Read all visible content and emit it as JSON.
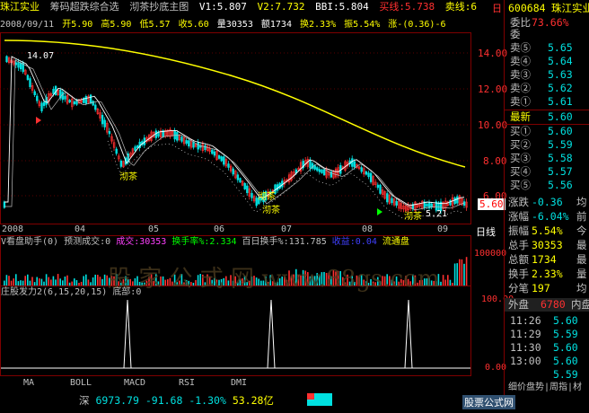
{
  "header": {
    "stock_name": "珠江实业",
    "indicator_name": "筹码超跌综合选",
    "indicator2_name": "沏茶抄底主图",
    "v1": "V1:5.807",
    "v2": "V2:7.732",
    "bbi": "BBI:5.804",
    "buy_line": "买线:5.738",
    "sell_line": "卖线:6",
    "corner_label": "日"
  },
  "info_row": {
    "date": "2008/09/11",
    "open": "开5.90",
    "high": "高5.90",
    "low": "低5.57",
    "close": "收5.60",
    "volume": "量30353",
    "amount": "额1734",
    "turnover": "换2.33%",
    "amplitude": "振5.54%",
    "change": "涨-(0.36)-6"
  },
  "main_chart": {
    "price_labels": [
      "14.00",
      "12.00",
      "10.00",
      "8.00",
      "6.00"
    ],
    "current_price": "5.60",
    "high_annotation": "14.07",
    "low_annotation": "5.21",
    "marker_labels": [
      "沏茶",
      "沏茶",
      "沏茶",
      "沏茶"
    ],
    "date_labels": [
      "2008",
      "04",
      "05",
      "06",
      "07",
      "08",
      "09"
    ],
    "period_label": "日线",
    "colors": {
      "up": "#ff3030",
      "down": "#00e0e0",
      "ma_long": "#ffff00",
      "ma_white": "#ffffff"
    }
  },
  "volume_panel": {
    "title": "V看盘助手(0)",
    "items": [
      {
        "label": "预测成交:0",
        "color": "#c0c0c0"
      },
      {
        "label": "成交:30353",
        "color": "#ff40ff"
      },
      {
        "label": "换手率%:2.334",
        "color": "#00ff00"
      },
      {
        "label": "百日换手%:131.785",
        "color": "#c0c0c0"
      },
      {
        "label": "收益:0.04",
        "color": "#4040ff"
      },
      {
        "label": "流通盘",
        "color": "#ffff00"
      }
    ],
    "axis_label": "100000"
  },
  "bottom_panel": {
    "title": "庄股发力2(6,15,20,15)",
    "subtitle": "底部:0",
    "axis_top": "100.00",
    "axis_bottom": "0.00"
  },
  "watermark": "股 家 公 式 网 www.88gs.com",
  "tabs": [
    "MA",
    "BOLL",
    "MACD",
    "RSI",
    "DMI"
  ],
  "status": {
    "index_name": "深",
    "index_value": "6973.79",
    "index_change": "-91.68",
    "index_pct": "-1.30%",
    "amount": "53.28亿",
    "site": "股票公式网"
  },
  "quote_panel": {
    "code": "600684",
    "name": "珠江实业",
    "wei_bi_label": "委比",
    "wei_bi": "73.66%",
    "wei_cha_label": "委",
    "sells": [
      {
        "label": "卖⑤",
        "price": "5.65"
      },
      {
        "label": "卖④",
        "price": "5.64"
      },
      {
        "label": "卖③",
        "price": "5.63"
      },
      {
        "label": "卖②",
        "price": "5.62"
      },
      {
        "label": "卖①",
        "price": "5.61"
      }
    ],
    "latest_label": "最新",
    "latest": "5.60",
    "buys": [
      {
        "label": "买①",
        "price": "5.60"
      },
      {
        "label": "买②",
        "price": "5.59"
      },
      {
        "label": "买③",
        "price": "5.58"
      },
      {
        "label": "买④",
        "price": "5.57"
      },
      {
        "label": "买⑤",
        "price": "5.56"
      }
    ],
    "stats": [
      {
        "label": "涨跌",
        "value": "-0.36",
        "extra": "均"
      },
      {
        "label": "涨幅",
        "value": "-6.04%",
        "extra": "前"
      },
      {
        "label": "振幅",
        "value": "5.54%",
        "extra": "今"
      },
      {
        "label": "总手",
        "value": "30353",
        "extra": "最"
      },
      {
        "label": "总额",
        "value": "1734",
        "extra": "最"
      },
      {
        "label": "换手",
        "value": "2.33%",
        "extra": "量"
      },
      {
        "label": "分笔",
        "value": "197",
        "extra": "均"
      }
    ],
    "outer_label": "外盘",
    "outer_value": "6780",
    "inner_label": "内盘",
    "ticks": [
      {
        "time": "11:26",
        "price": "5.60"
      },
      {
        "time": "11:29",
        "price": "5.59"
      },
      {
        "time": "11:30",
        "price": "5.60"
      },
      {
        "time": "13:00",
        "price": "5.60"
      },
      {
        "time": "",
        "price": "5.59"
      }
    ],
    "bottom_label": "细价盘势|周指|材"
  }
}
